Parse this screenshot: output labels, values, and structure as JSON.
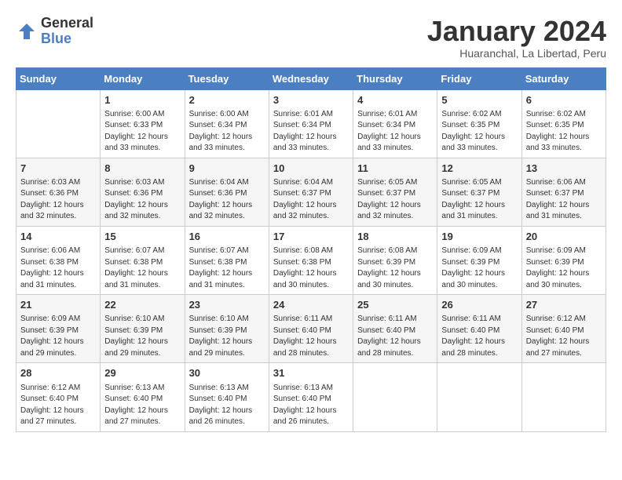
{
  "logo": {
    "general": "General",
    "blue": "Blue"
  },
  "title": "January 2024",
  "subtitle": "Huaranchal, La Libertad, Peru",
  "days_of_week": [
    "Sunday",
    "Monday",
    "Tuesday",
    "Wednesday",
    "Thursday",
    "Friday",
    "Saturday"
  ],
  "weeks": [
    [
      {
        "day": "",
        "info": ""
      },
      {
        "day": "1",
        "info": "Sunrise: 6:00 AM\nSunset: 6:33 PM\nDaylight: 12 hours\nand 33 minutes."
      },
      {
        "day": "2",
        "info": "Sunrise: 6:00 AM\nSunset: 6:34 PM\nDaylight: 12 hours\nand 33 minutes."
      },
      {
        "day": "3",
        "info": "Sunrise: 6:01 AM\nSunset: 6:34 PM\nDaylight: 12 hours\nand 33 minutes."
      },
      {
        "day": "4",
        "info": "Sunrise: 6:01 AM\nSunset: 6:34 PM\nDaylight: 12 hours\nand 33 minutes."
      },
      {
        "day": "5",
        "info": "Sunrise: 6:02 AM\nSunset: 6:35 PM\nDaylight: 12 hours\nand 33 minutes."
      },
      {
        "day": "6",
        "info": "Sunrise: 6:02 AM\nSunset: 6:35 PM\nDaylight: 12 hours\nand 33 minutes."
      }
    ],
    [
      {
        "day": "7",
        "info": "Sunrise: 6:03 AM\nSunset: 6:36 PM\nDaylight: 12 hours\nand 32 minutes."
      },
      {
        "day": "8",
        "info": "Sunrise: 6:03 AM\nSunset: 6:36 PM\nDaylight: 12 hours\nand 32 minutes."
      },
      {
        "day": "9",
        "info": "Sunrise: 6:04 AM\nSunset: 6:36 PM\nDaylight: 12 hours\nand 32 minutes."
      },
      {
        "day": "10",
        "info": "Sunrise: 6:04 AM\nSunset: 6:37 PM\nDaylight: 12 hours\nand 32 minutes."
      },
      {
        "day": "11",
        "info": "Sunrise: 6:05 AM\nSunset: 6:37 PM\nDaylight: 12 hours\nand 32 minutes."
      },
      {
        "day": "12",
        "info": "Sunrise: 6:05 AM\nSunset: 6:37 PM\nDaylight: 12 hours\nand 31 minutes."
      },
      {
        "day": "13",
        "info": "Sunrise: 6:06 AM\nSunset: 6:37 PM\nDaylight: 12 hours\nand 31 minutes."
      }
    ],
    [
      {
        "day": "14",
        "info": "Sunrise: 6:06 AM\nSunset: 6:38 PM\nDaylight: 12 hours\nand 31 minutes."
      },
      {
        "day": "15",
        "info": "Sunrise: 6:07 AM\nSunset: 6:38 PM\nDaylight: 12 hours\nand 31 minutes."
      },
      {
        "day": "16",
        "info": "Sunrise: 6:07 AM\nSunset: 6:38 PM\nDaylight: 12 hours\nand 31 minutes."
      },
      {
        "day": "17",
        "info": "Sunrise: 6:08 AM\nSunset: 6:38 PM\nDaylight: 12 hours\nand 30 minutes."
      },
      {
        "day": "18",
        "info": "Sunrise: 6:08 AM\nSunset: 6:39 PM\nDaylight: 12 hours\nand 30 minutes."
      },
      {
        "day": "19",
        "info": "Sunrise: 6:09 AM\nSunset: 6:39 PM\nDaylight: 12 hours\nand 30 minutes."
      },
      {
        "day": "20",
        "info": "Sunrise: 6:09 AM\nSunset: 6:39 PM\nDaylight: 12 hours\nand 30 minutes."
      }
    ],
    [
      {
        "day": "21",
        "info": "Sunrise: 6:09 AM\nSunset: 6:39 PM\nDaylight: 12 hours\nand 29 minutes."
      },
      {
        "day": "22",
        "info": "Sunrise: 6:10 AM\nSunset: 6:39 PM\nDaylight: 12 hours\nand 29 minutes."
      },
      {
        "day": "23",
        "info": "Sunrise: 6:10 AM\nSunset: 6:39 PM\nDaylight: 12 hours\nand 29 minutes."
      },
      {
        "day": "24",
        "info": "Sunrise: 6:11 AM\nSunset: 6:40 PM\nDaylight: 12 hours\nand 28 minutes."
      },
      {
        "day": "25",
        "info": "Sunrise: 6:11 AM\nSunset: 6:40 PM\nDaylight: 12 hours\nand 28 minutes."
      },
      {
        "day": "26",
        "info": "Sunrise: 6:11 AM\nSunset: 6:40 PM\nDaylight: 12 hours\nand 28 minutes."
      },
      {
        "day": "27",
        "info": "Sunrise: 6:12 AM\nSunset: 6:40 PM\nDaylight: 12 hours\nand 27 minutes."
      }
    ],
    [
      {
        "day": "28",
        "info": "Sunrise: 6:12 AM\nSunset: 6:40 PM\nDaylight: 12 hours\nand 27 minutes."
      },
      {
        "day": "29",
        "info": "Sunrise: 6:13 AM\nSunset: 6:40 PM\nDaylight: 12 hours\nand 27 minutes."
      },
      {
        "day": "30",
        "info": "Sunrise: 6:13 AM\nSunset: 6:40 PM\nDaylight: 12 hours\nand 26 minutes."
      },
      {
        "day": "31",
        "info": "Sunrise: 6:13 AM\nSunset: 6:40 PM\nDaylight: 12 hours\nand 26 minutes."
      },
      {
        "day": "",
        "info": ""
      },
      {
        "day": "",
        "info": ""
      },
      {
        "day": "",
        "info": ""
      }
    ]
  ]
}
